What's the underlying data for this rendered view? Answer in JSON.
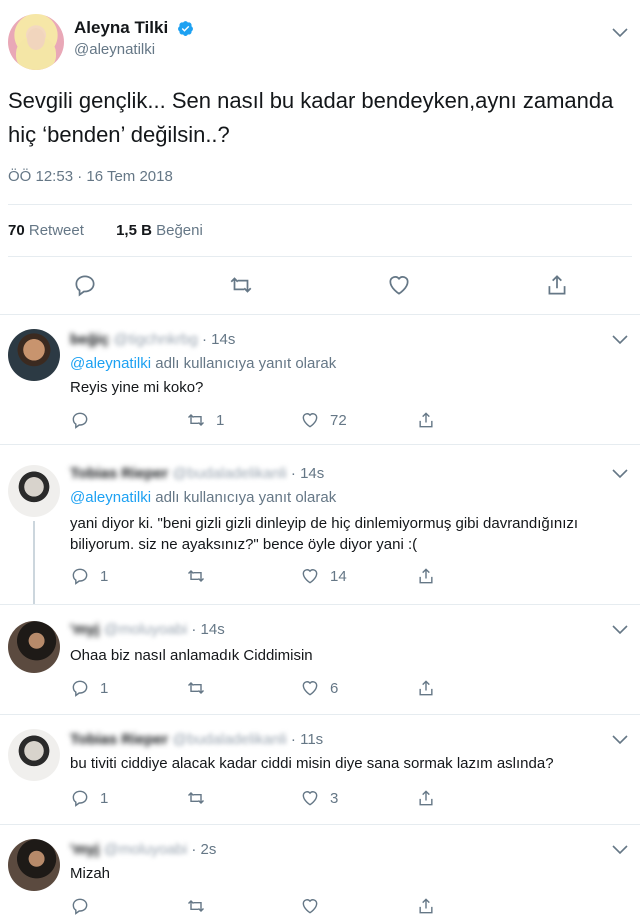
{
  "main": {
    "display_name": "Aleyna Tilki",
    "handle": "@aleynatilki",
    "text": "Sevgili gençlik... Sen nasıl bu kadar bendeyken,aynı zamanda hiç ‘benden’ değilsin..?",
    "timestamp": "ÖÖ 12:53 · 16 Tem 2018",
    "retweets_count": "70",
    "retweets_label": "Retweet",
    "likes_count": "1,5 B",
    "likes_label": "Beğeni"
  },
  "replying_to": {
    "mention": "@aleynatilki",
    "suffix": " adlı kullanıcıya yanıt olarak"
  },
  "replies": [
    {
      "name": "beğiç",
      "handle": "@tigchnkrbg",
      "time": "· 14s",
      "text": "Reyis yine mi koko?",
      "replies": "",
      "retweets": "1",
      "likes": "72"
    },
    {
      "name": "Tobias Rieper",
      "handle": "@budaladelikanli",
      "time": "· 14s",
      "text": "yani diyor ki. \"beni gizli gizli dinleyip de hiç dinlemiyormuş gibi davrandığınızı biliyorum. siz ne ayaksınız?\" bence öyle diyor yani :(",
      "replies": "1",
      "retweets": "",
      "likes": "14"
    },
    {
      "name": "'myj",
      "handle": "@moluyoabi",
      "time": "· 14s",
      "text": "Ohaa biz nasıl anlamadık Ciddimisin",
      "replies": "1",
      "retweets": "",
      "likes": "6"
    },
    {
      "name": "Tobias Rieper",
      "handle": "@budaladelikanli",
      "time": "· 11s",
      "text": "bu tiviti ciddiye alacak kadar ciddi misin diye sana sormak lazım aslında?",
      "replies": "1",
      "retweets": "",
      "likes": "3"
    },
    {
      "name": "'myj",
      "handle": "@moluyoabi",
      "time": "· 2s",
      "text": "Mizah",
      "replies": "",
      "retweets": "",
      "likes": ""
    }
  ],
  "colors": {
    "accent": "#1da1f2",
    "secondary_text": "#657786",
    "icon": "#657786"
  }
}
